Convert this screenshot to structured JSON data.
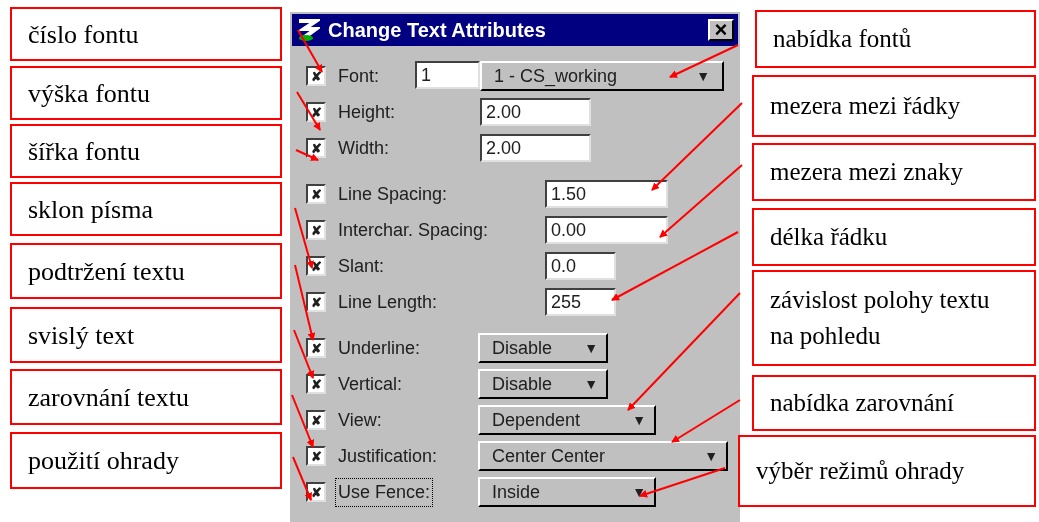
{
  "left_callouts": [
    "číslo fontu",
    "výška fontu",
    "šířka fontu",
    "sklon písma",
    "podtržení textu",
    "svislý text",
    "zarovnání textu",
    "použití ohrady"
  ],
  "dialog": {
    "title": "Change Text Attributes",
    "close": "×",
    "sections": [
      {
        "rows": [
          {
            "kind": "font",
            "checked": true,
            "label": "Font:",
            "number": "1",
            "value": "1 - CS_working",
            "arrow": "▼"
          },
          {
            "kind": "field",
            "checked": true,
            "label": "Height:",
            "value": "2.00"
          },
          {
            "kind": "field",
            "checked": true,
            "label": "Width:",
            "value": "2.00"
          }
        ]
      },
      {
        "rows": [
          {
            "kind": "field",
            "checked": true,
            "label": "Line Spacing:",
            "value": "1.50"
          },
          {
            "kind": "field",
            "checked": true,
            "label": "Interchar. Spacing:",
            "value": "0.00"
          },
          {
            "kind": "field",
            "checked": true,
            "label": "Slant:",
            "value": "0.0"
          },
          {
            "kind": "field",
            "checked": true,
            "label": "Line Length:",
            "value": "255"
          }
        ]
      },
      {
        "rows": [
          {
            "kind": "dropdown",
            "checked": true,
            "label": "Underline:",
            "value": "Disable",
            "arrow": "▼"
          },
          {
            "kind": "dropdown",
            "checked": true,
            "label": "Vertical:",
            "value": "Disable",
            "arrow": "▼"
          },
          {
            "kind": "dropdown",
            "checked": true,
            "label": "View:",
            "value": "Dependent",
            "arrow": "▼"
          },
          {
            "kind": "dropdown",
            "checked": true,
            "label": "Justification:",
            "value": "Center Center",
            "arrow": "▼"
          },
          {
            "kind": "dropdown",
            "checked": true,
            "focused": true,
            "label": "Use Fence:",
            "value": "Inside",
            "arrow": "▼"
          }
        ]
      }
    ]
  },
  "right_callouts": [
    "nabídka fontů",
    "mezera mezi řádky",
    "mezera mezi znaky",
    "délka řádku",
    "závislost polohy textu na pohledu",
    "nabídka zarovnání",
    "výběr režimů ohrady"
  ],
  "check_mark": "✘"
}
